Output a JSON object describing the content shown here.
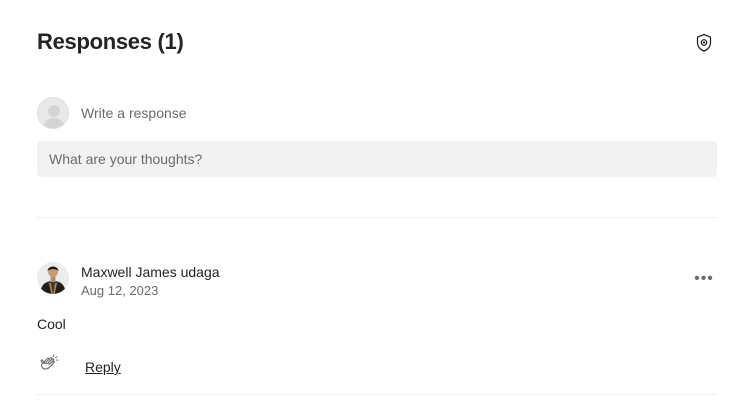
{
  "header": {
    "title": "Responses (1)",
    "shield_icon": "shield-icon"
  },
  "composer": {
    "label": "Write a response",
    "placeholder": "What are your thoughts?",
    "avatar_icon": "default-avatar-icon"
  },
  "responses": [
    {
      "author": "Maxwell James udaga",
      "date": "Aug 12, 2023",
      "body": "Cool",
      "reply_label": "Reply",
      "clap_icon": "clap-icon",
      "more_icon": "more-options-icon",
      "more_glyph": "•••"
    }
  ],
  "colors": {
    "text_primary": "#242424",
    "text_secondary": "#6b6b6b",
    "input_bg": "#f2f2f2",
    "divider": "#f0f0f0"
  }
}
